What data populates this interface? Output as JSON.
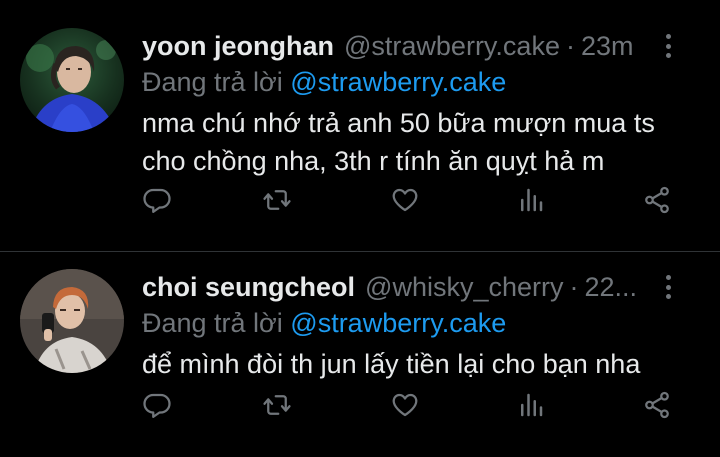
{
  "tweets": [
    {
      "name": "yoon jeonghan",
      "handle": "@strawberry.cake",
      "separator": "·",
      "time": "23m",
      "reply_prefix": "Đang trả lời",
      "reply_to": "@strawberry.cake",
      "text_line1": "nma chú nhớ trả anh 50 bữa mượn mua ts",
      "text_line2": "cho chồng nha, 3th r tính ăn quỵt hả m"
    },
    {
      "name": "choi seungcheol",
      "handle": "@whisky_cherry",
      "separator": "·",
      "time": "22...",
      "reply_prefix": "Đang trả lời",
      "reply_to": "@strawberry.cake",
      "text_line1": "để mình đòi th jun lấy tiền lại cho bạn nha"
    }
  ],
  "icons": [
    "more-icon",
    "reply-icon",
    "retweet-icon",
    "like-icon",
    "views-icon",
    "share-icon"
  ],
  "colors": {
    "background": "#000000",
    "text": "#e7e9ea",
    "muted": "#71767b",
    "mention": "#1d9bf0",
    "divider": "#2f3336"
  }
}
